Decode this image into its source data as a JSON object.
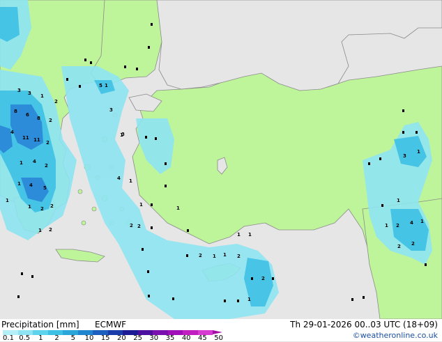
{
  "legend": {
    "title": "Precipitation [mm]",
    "model": "ECMWF",
    "ticks": [
      "0.1",
      "0.5",
      "1",
      "2",
      "5",
      "10",
      "15",
      "20",
      "25",
      "30",
      "35",
      "40",
      "45",
      "50"
    ],
    "colors": [
      "#b4eef6",
      "#8ee4f2",
      "#5ed3ec",
      "#3ec0e4",
      "#2aa6d8",
      "#1f86cf",
      "#1c5fbf",
      "#1a3cab",
      "#1c1b96",
      "#4d0fa0",
      "#7a10b0",
      "#a00fb8",
      "#c01ec0",
      "#d83bd0"
    ]
  },
  "date_text": "Th 29-01-2026 00..03 UTC (18+09)",
  "credit": "©weatheronline.co.uk",
  "map_colors": {
    "sea": "#e6e6e6",
    "land": "#bff59a",
    "coast": "#8a8a8a"
  },
  "precip_values": [
    "3",
    "3",
    "1",
    "8",
    "6",
    "8",
    "2",
    "4",
    "11",
    "11",
    "2",
    "4",
    "2",
    "1",
    "4",
    "5",
    "1",
    "2",
    "1",
    "1",
    "2",
    "2",
    "3",
    "1",
    "1",
    "5",
    "3",
    "4",
    "1",
    "1",
    "1",
    "2",
    "1",
    "1",
    "2",
    "1",
    "2",
    "2",
    "1",
    "1",
    "2",
    "4",
    "1",
    "2",
    "3",
    "2",
    "1",
    "2",
    "2",
    "1",
    "1",
    "1"
  ]
}
